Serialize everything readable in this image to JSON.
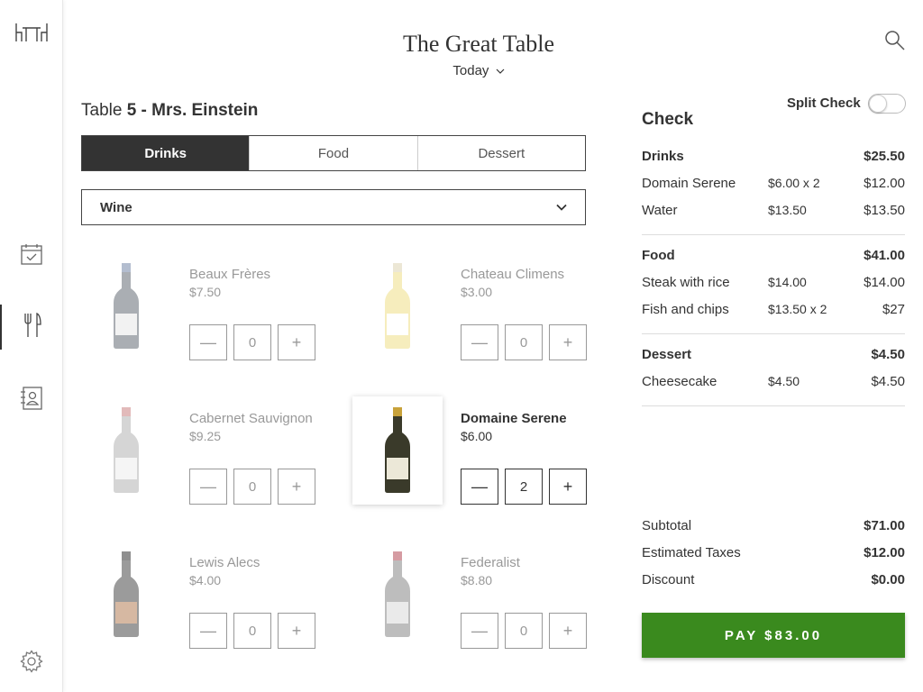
{
  "app": {
    "title": "The Great Table",
    "date_label": "Today"
  },
  "icons": {
    "logo": "table-chairs-logo-icon",
    "calendar": "calendar-check-icon",
    "menu": "fork-knife-icon",
    "contacts": "contact-card-icon",
    "settings": "gear-icon",
    "search": "search-icon"
  },
  "table": {
    "prefix": "Table ",
    "number": "5",
    "guest": " - Mrs. Einstein"
  },
  "tabs": [
    {
      "label": "Drinks",
      "active": true
    },
    {
      "label": "Food",
      "active": false
    },
    {
      "label": "Dessert",
      "active": false
    }
  ],
  "category": {
    "selected": "Wine"
  },
  "products": [
    {
      "name": "Beaux Frères",
      "price": "$7.50",
      "qty": "0",
      "minus": "—",
      "plus": "+",
      "bottle": "#8e949a",
      "label": "#eeeeee",
      "cap": "#9aa8c0",
      "selected": false
    },
    {
      "name": "Chateau Climens",
      "price": "$3.00",
      "qty": "0",
      "minus": "—",
      "plus": "+",
      "bottle": "#f3e7a8",
      "label": "#ffffff",
      "cap": "#e6e0c8",
      "selected": false
    },
    {
      "name": "Cabernet Sauvignon",
      "price": "$9.25",
      "qty": "0",
      "minus": "—",
      "plus": "+",
      "bottle": "#c8c8c8",
      "label": "#f2f2f2",
      "cap": "#d9a3a3",
      "selected": false
    },
    {
      "name": "Domaine Serene",
      "price": "$6.00",
      "qty": "2",
      "minus": "—",
      "plus": "+",
      "bottle": "#3a3a2a",
      "label": "#ece8d8",
      "cap": "#c8a23a",
      "selected": true
    },
    {
      "name": "Lewis Alecs",
      "price": "$4.00",
      "qty": "0",
      "minus": "—",
      "plus": "+",
      "bottle": "#7a7a7a",
      "label": "#c9a183",
      "cap": "#6a6a6a",
      "selected": false
    },
    {
      "name": "Federalist",
      "price": "$8.80",
      "qty": "0",
      "minus": "—",
      "plus": "+",
      "bottle": "#a8a8a8",
      "label": "#e4e4e4",
      "cap": "#c77a84",
      "selected": false
    }
  ],
  "check": {
    "title": "Check",
    "split_label": "Split Check",
    "split_on": false,
    "sections": [
      {
        "name": "Drinks",
        "total": "$25.50",
        "items": [
          {
            "name": "Domain Serene",
            "unit": "$6.00 x 2",
            "total": "$12.00"
          },
          {
            "name": "Water",
            "unit": "$13.50",
            "total": "$13.50"
          }
        ]
      },
      {
        "name": "Food",
        "total": "$41.00",
        "items": [
          {
            "name": "Steak with rice",
            "unit": "$14.00",
            "total": "$14.00"
          },
          {
            "name": "Fish and chips",
            "unit": "$13.50  x 2",
            "total": "$27"
          }
        ]
      },
      {
        "name": "Dessert",
        "total": "$4.50",
        "items": [
          {
            "name": "Cheesecake",
            "unit": "$4.50",
            "total": "$4.50"
          }
        ]
      }
    ],
    "summary": {
      "subtotal_label": "Subtotal",
      "subtotal": "$71.00",
      "taxes_label": "Estimated Taxes",
      "taxes": "$12.00",
      "discount_label": "Discount",
      "discount": "$0.00"
    },
    "pay_label": "PAY $83.00",
    "pay_color": "#3a8a1e"
  }
}
